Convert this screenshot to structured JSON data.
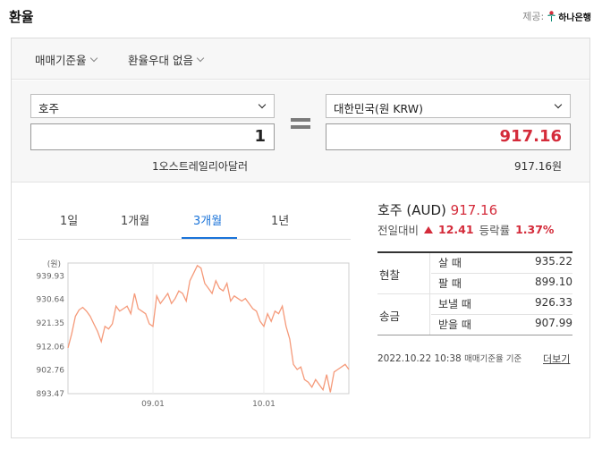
{
  "header": {
    "title": "환율",
    "provider_label": "제공:",
    "provider_name": "하나은행"
  },
  "filters": {
    "rate_basis": "매매기준율",
    "preferential": "환율우대 없음"
  },
  "converter": {
    "from_currency": "호주",
    "from_amount": "1",
    "from_desc": "1오스트레일리아달러",
    "to_currency": "대한민국(원 KRW)",
    "to_amount": "917.16",
    "to_desc": "917.16원"
  },
  "tabs": [
    {
      "label": "1일"
    },
    {
      "label": "1개월"
    },
    {
      "label": "3개월"
    },
    {
      "label": "1년"
    }
  ],
  "active_tab": 2,
  "summary": {
    "currency": "호주 (AUD)",
    "value": "917.16",
    "day_label": "전일대비",
    "day_change": "12.41",
    "rate_label": "등락률",
    "rate_change": "1.37%"
  },
  "rates": {
    "cash_label": "현찰",
    "transfer_label": "송금",
    "buy_label": "살 때",
    "buy_value": "935.22",
    "sell_label": "팔 때",
    "sell_value": "899.10",
    "send_label": "보낼 때",
    "send_value": "926.33",
    "receive_label": "받을 때",
    "receive_value": "907.99"
  },
  "footer": {
    "timestamp": "2022.10.22 10:38",
    "basis_note": "매매기준율 기준",
    "more_label": "더보기"
  },
  "colors": {
    "accent_blue": "#1a73d9",
    "up_red": "#d42b3a",
    "line_orange": "#f59a7a"
  },
  "chart_data": {
    "type": "line",
    "ylabel": "(원)",
    "y_ticks": [
      "939.93",
      "930.64",
      "921.35",
      "912.06",
      "902.76",
      "893.47"
    ],
    "ylim": [
      893.47,
      945
    ],
    "x_ticks": [
      {
        "label": "09.01",
        "at": 23
      },
      {
        "label": "10.01",
        "at": 53
      }
    ],
    "series": [
      {
        "values": [
          911.5,
          917,
          924,
          926.5,
          927.5,
          926,
          924,
          921,
          918,
          914,
          920,
          919,
          921,
          928,
          926,
          927,
          928,
          925,
          933,
          927,
          926,
          925,
          921,
          920,
          932,
          929,
          931,
          933,
          929,
          931,
          934,
          933,
          930,
          938,
          941,
          944,
          943,
          937,
          935,
          933,
          938,
          935,
          934,
          937,
          930,
          932,
          931,
          930,
          931,
          929,
          927,
          926,
          922,
          920,
          925,
          922,
          926,
          925,
          928,
          920,
          915,
          905,
          903,
          904,
          899,
          898,
          896,
          899,
          897,
          895,
          901,
          894,
          902,
          903,
          904,
          905,
          903
        ]
      }
    ]
  }
}
